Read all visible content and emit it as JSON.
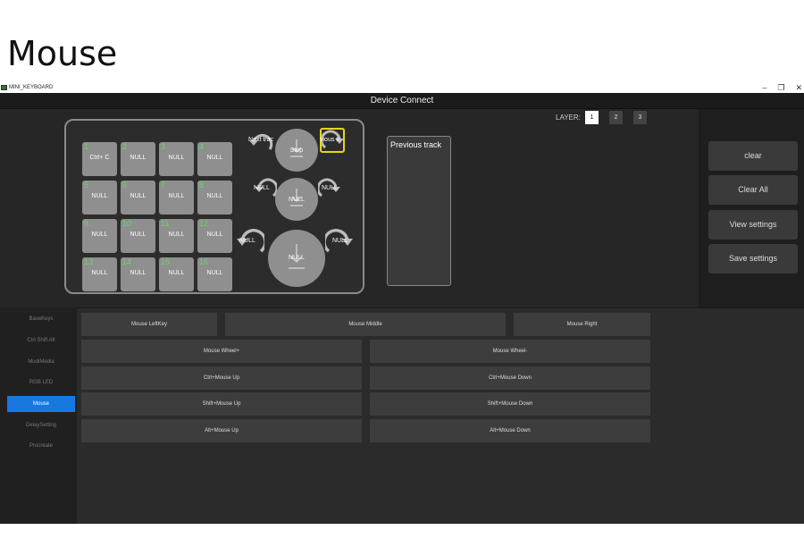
{
  "page_heading": "Mouse",
  "window": {
    "app_title": "MINI_KEYBOARD",
    "status": "Device Connect"
  },
  "layer": {
    "label": "LAYER:",
    "buttons": [
      "1",
      "2",
      "3"
    ],
    "active": "1"
  },
  "keys": [
    {
      "num": "1",
      "label": "Ctrl+ C"
    },
    {
      "num": "2",
      "label": "NULL"
    },
    {
      "num": "3",
      "label": "NULL"
    },
    {
      "num": "4",
      "label": "NULL"
    },
    {
      "num": "5",
      "label": "NULL"
    },
    {
      "num": "6",
      "label": "NULL"
    },
    {
      "num": "7",
      "label": "NULL"
    },
    {
      "num": "8",
      "label": "NULL"
    },
    {
      "num": "9",
      "label": "NULL"
    },
    {
      "num": "10",
      "label": "NULL"
    },
    {
      "num": "11",
      "label": "NULL"
    },
    {
      "num": "12",
      "label": "NULL"
    },
    {
      "num": "13",
      "label": "NULL"
    },
    {
      "num": "14",
      "label": "NULL"
    },
    {
      "num": "15",
      "label": "NULL"
    },
    {
      "num": "16",
      "label": "NULL"
    }
  ],
  "knobs": [
    {
      "center": "Stop",
      "left": "Next trac",
      "right": "vious tr"
    },
    {
      "center": "NULL",
      "left": "NULL",
      "right": "NULL"
    },
    {
      "center": "NULL",
      "left": "NULL",
      "right": "NULL"
    }
  ],
  "preview_text": "Previous track",
  "actions": [
    "clear",
    "Clear All",
    "View settings",
    "Save settings"
  ],
  "nav": {
    "items": [
      "BaseKeys",
      "Ctrl Shift Alt",
      "MudiMedia",
      "RGB LED",
      "Mouse",
      "DelaySetting",
      "Procreate"
    ],
    "active": "Mouse"
  },
  "mouse_buttons": [
    "Mouse LeftKey",
    "Mouse Middle",
    "Mouse Right",
    "Mouse Wheel+",
    "Mouse Wheel-",
    "Ctrl+Mouse Up",
    "Ctrl+Mouse Down",
    "Shift+Mouse Up",
    "Shift+Mouse Down",
    "Alt+Mouse Up",
    "Alt+Mouse Down"
  ],
  "colors": {
    "accent": "#1778e0",
    "highlight": "#e4d51d",
    "key_number": "#6cd36c"
  }
}
